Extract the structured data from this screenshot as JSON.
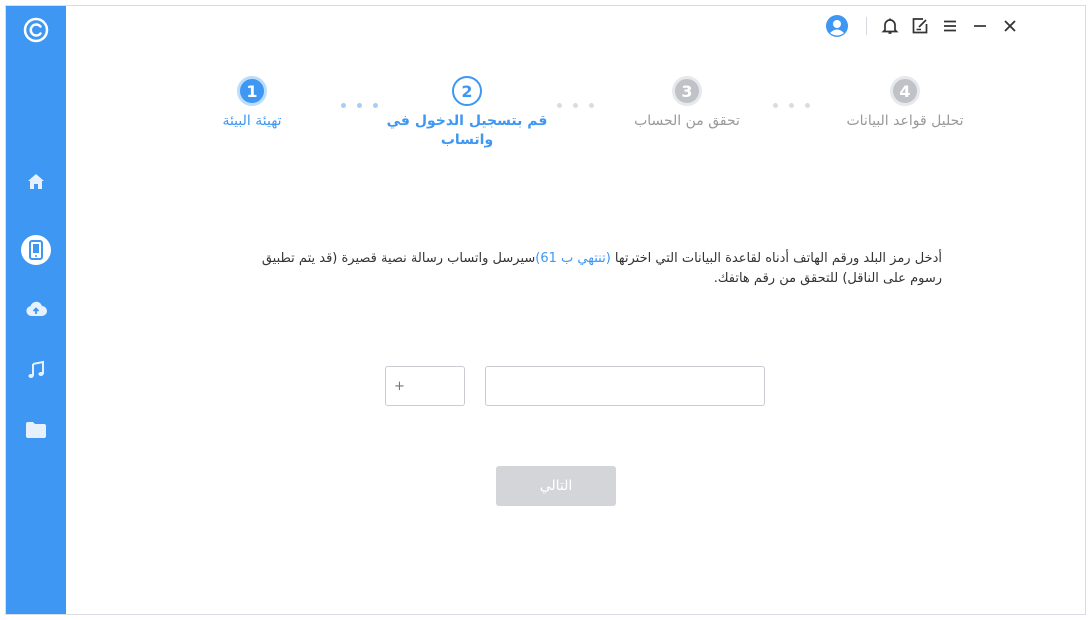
{
  "colors": {
    "accent": "#3d97f3",
    "disabled": "#d3d5d8",
    "pending": "#bfc3c8",
    "dot_active": "#a9cdf6",
    "dot_pending": "#d9dce0"
  },
  "sidebar": {
    "logo_icon": "logo-c-icon",
    "items": [
      {
        "icon": "home-icon",
        "active": false
      },
      {
        "icon": "phone-icon",
        "active": true
      },
      {
        "icon": "cloud-upload-icon",
        "active": false
      },
      {
        "icon": "music-icon",
        "active": false
      },
      {
        "icon": "folder-icon",
        "active": false
      }
    ]
  },
  "topbar": {
    "icons": [
      "user-avatar-icon",
      "bell-icon",
      "feedback-icon",
      "menu-icon",
      "minimize-icon",
      "close-icon"
    ]
  },
  "steps": [
    {
      "number": "1",
      "label": "تهيئة البيئة",
      "state": "done"
    },
    {
      "number": "2",
      "label_line1": "قم بتسجيل الدخول في",
      "label_line2": "واتساب",
      "state": "active"
    },
    {
      "number": "3",
      "label": "تحقق من الحساب",
      "state": "pending"
    },
    {
      "number": "4",
      "label": "تحليل قواعد البيانات",
      "state": "pending"
    }
  ],
  "instructions": {
    "part1": "أدخل رمز البلد ورقم الهاتف أدناه لقاعدة البيانات التي اخترتها ",
    "highlight": "(تنتهي ب 61)",
    "part2": "سيرسل واتساب رسالة نصية قصيرة (قد يتم تطبيق رسوم على الناقل) للتحقق من رقم هاتفك."
  },
  "form": {
    "country_code_placeholder": "+",
    "phone_value": "",
    "next_label": "التالي"
  }
}
